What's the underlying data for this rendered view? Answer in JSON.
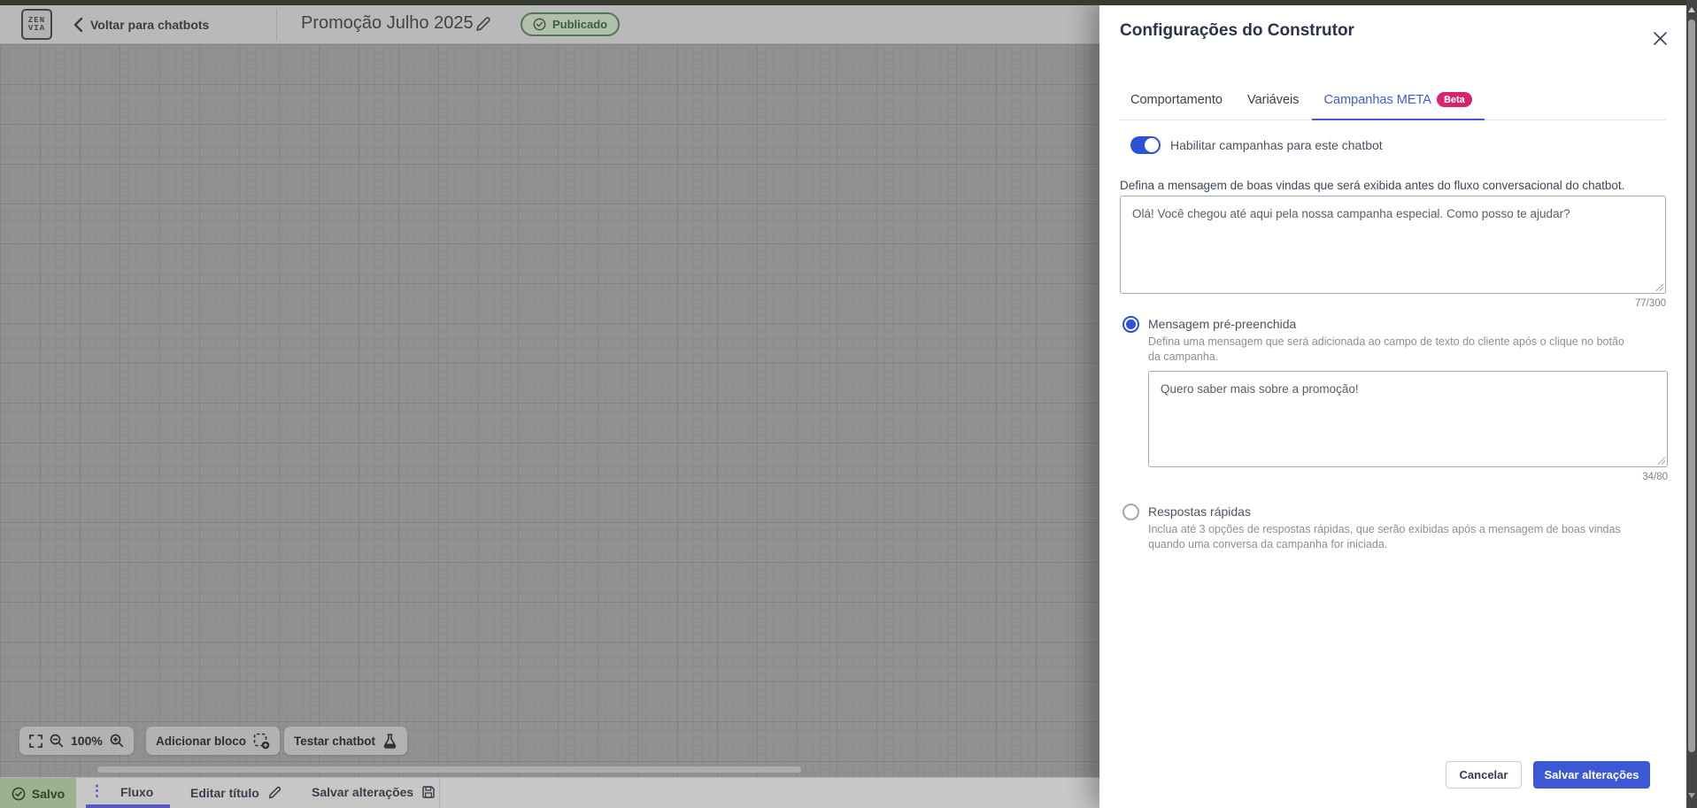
{
  "header": {
    "back": "Voltar para chatbots",
    "title": "Promoção Julho 2025",
    "status": "Publicado"
  },
  "logo": {
    "line1": "ZEN",
    "line2": "VIA"
  },
  "canvas_toolbar": {
    "zoom_level": "100%",
    "add_block": "Adicionar bloco",
    "test_chatbot": "Testar chatbot"
  },
  "bottom_bar": {
    "saved": "Salvo",
    "flow_tab": "Fluxo",
    "edit_title": "Editar título",
    "save_changes": "Salvar alterações"
  },
  "icons": {
    "dots_vertical": "⋮"
  },
  "drawer": {
    "title": "Configurações do Construtor",
    "tabs": [
      {
        "label": "Comportamento"
      },
      {
        "label": "Variáveis"
      },
      {
        "label": "Campanhas META",
        "badge": "Beta"
      }
    ],
    "enable_toggle_label": "Habilitar campanhas para este chatbot",
    "welcome_message": {
      "label": "Defina a mensagem de boas vindas que será exibida antes do fluxo conversacional do chatbot.",
      "value": "Olá! Você chegou até aqui pela nossa campanha especial. Como posso te ajudar?",
      "counter": "77/300"
    },
    "prefilled_message": {
      "label": "Mensagem pré-preenchida",
      "description": "Defina uma mensagem que será adicionada ao campo de texto do cliente após o clique no botão da campanha.",
      "value": "Quero saber mais sobre a promoção!",
      "counter": "34/80"
    },
    "quick_replies": {
      "label": "Respostas rápidas",
      "description": "Inclua até 3 opções de respostas rápidas, que serão exibidas após a mensagem de boas vindas quando uma conversa da campanha for iniciada."
    },
    "cancel": "Cancelar",
    "save": "Salvar alterações"
  },
  "colors": {
    "accent_blue": "#3b5cd9",
    "beta_pink": "#d6246e",
    "published_green": "#3d5c44",
    "flow_purple": "#5b57c2"
  }
}
